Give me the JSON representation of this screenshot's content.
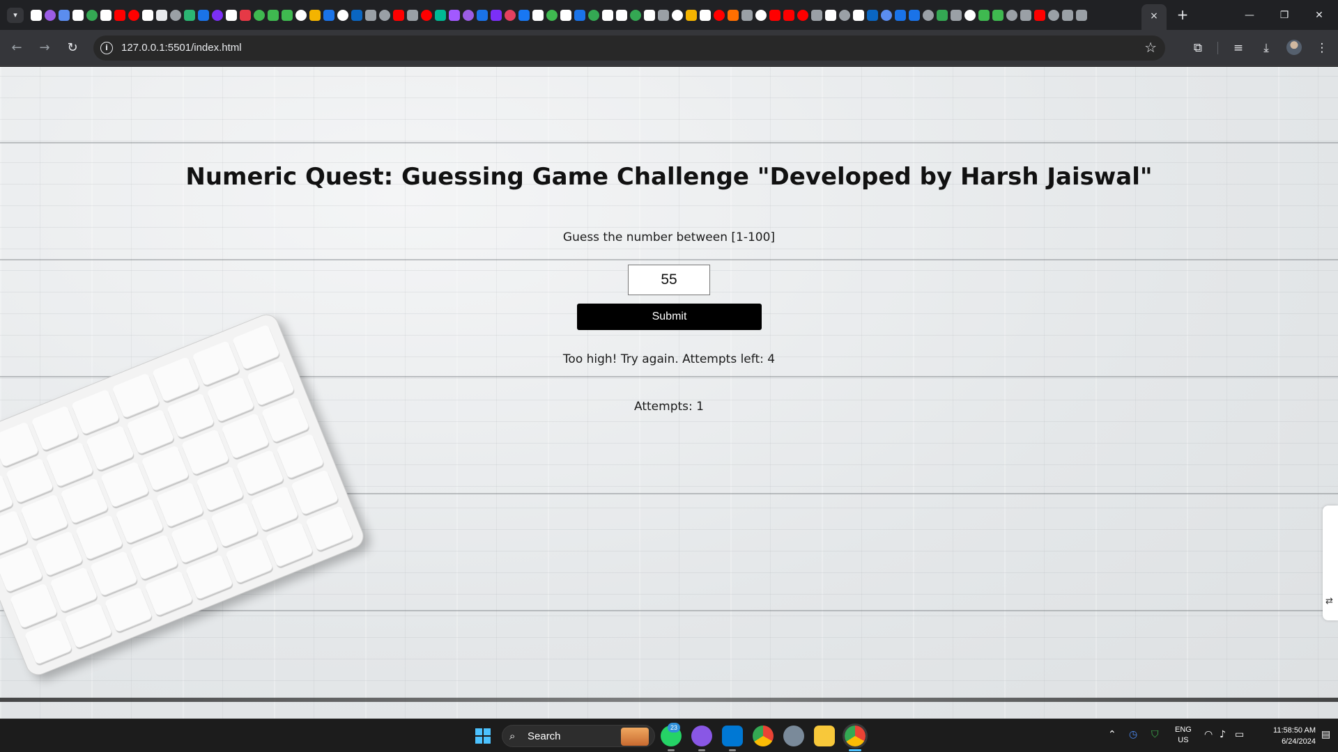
{
  "browser": {
    "url": "127.0.0.1:5501/index.html",
    "tab_close_glyph": "×",
    "new_tab_glyph": "+",
    "favicon_colors": [
      "#ffffff",
      "#9b5de5",
      "#5b8def",
      "#ffffff",
      "#34a853",
      "#ffffff",
      "#ff0000",
      "#ff0000",
      "#ffffff",
      "#e8eaed",
      "#9aa0a6",
      "#2bb673",
      "#1a73e8",
      "#7b2ff7",
      "#ffffff",
      "#e63946",
      "#3fb950",
      "#3fb950",
      "#3fb950",
      "#ffffff",
      "#f4b400",
      "#1a73e8",
      "#ffffff",
      "#0a66c2",
      "#9aa0a6",
      "#9aa0a6",
      "#ff0000",
      "#9aa0a6",
      "#ff0000",
      "#00b894",
      "#a259ff",
      "#9b5de5",
      "#1a73e8",
      "#7b2ff7",
      "#e4405f",
      "#1877f2",
      "#ffffff",
      "#3fb950",
      "#ffffff",
      "#1a73e8",
      "#34a853",
      "#ffffff",
      "#ffffff",
      "#34a853",
      "#ffffff",
      "#9aa0a6",
      "#ffffff",
      "#f4b400",
      "#ffffff",
      "#ff0000",
      "#ff6f00",
      "#9aa0a6",
      "#ffffff",
      "#ff0000",
      "#ff0000",
      "#ff0000",
      "#9aa0a6",
      "#ffffff",
      "#9aa0a6",
      "#ffffff",
      "#0a66c2",
      "#5b8def",
      "#1a73e8",
      "#1a73e8",
      "#9aa0a6",
      "#34a853",
      "#9aa0a6",
      "#ffffff",
      "#3fb950",
      "#3fb950",
      "#9aa0a6",
      "#9aa0a6",
      "#ff0000",
      "#9aa0a6",
      "#9aa0a6",
      "#9aa0a6"
    ]
  },
  "game": {
    "title": "Numeric Quest: Guessing Game Challenge \"Developed by Harsh Jaiswal\"",
    "instruction": "Guess the number between [1-100]",
    "guess_value": "55",
    "submit_label": "Submit",
    "feedback": "Too high! Try again. Attempts left: 4",
    "attempts": "Attempts: 1"
  },
  "taskbar": {
    "search_label": "Search",
    "whatsapp_badge": "23",
    "lang_line1": "ENG",
    "lang_line2": "US",
    "time": "11:58:50 AM",
    "date": "6/24/2024"
  }
}
